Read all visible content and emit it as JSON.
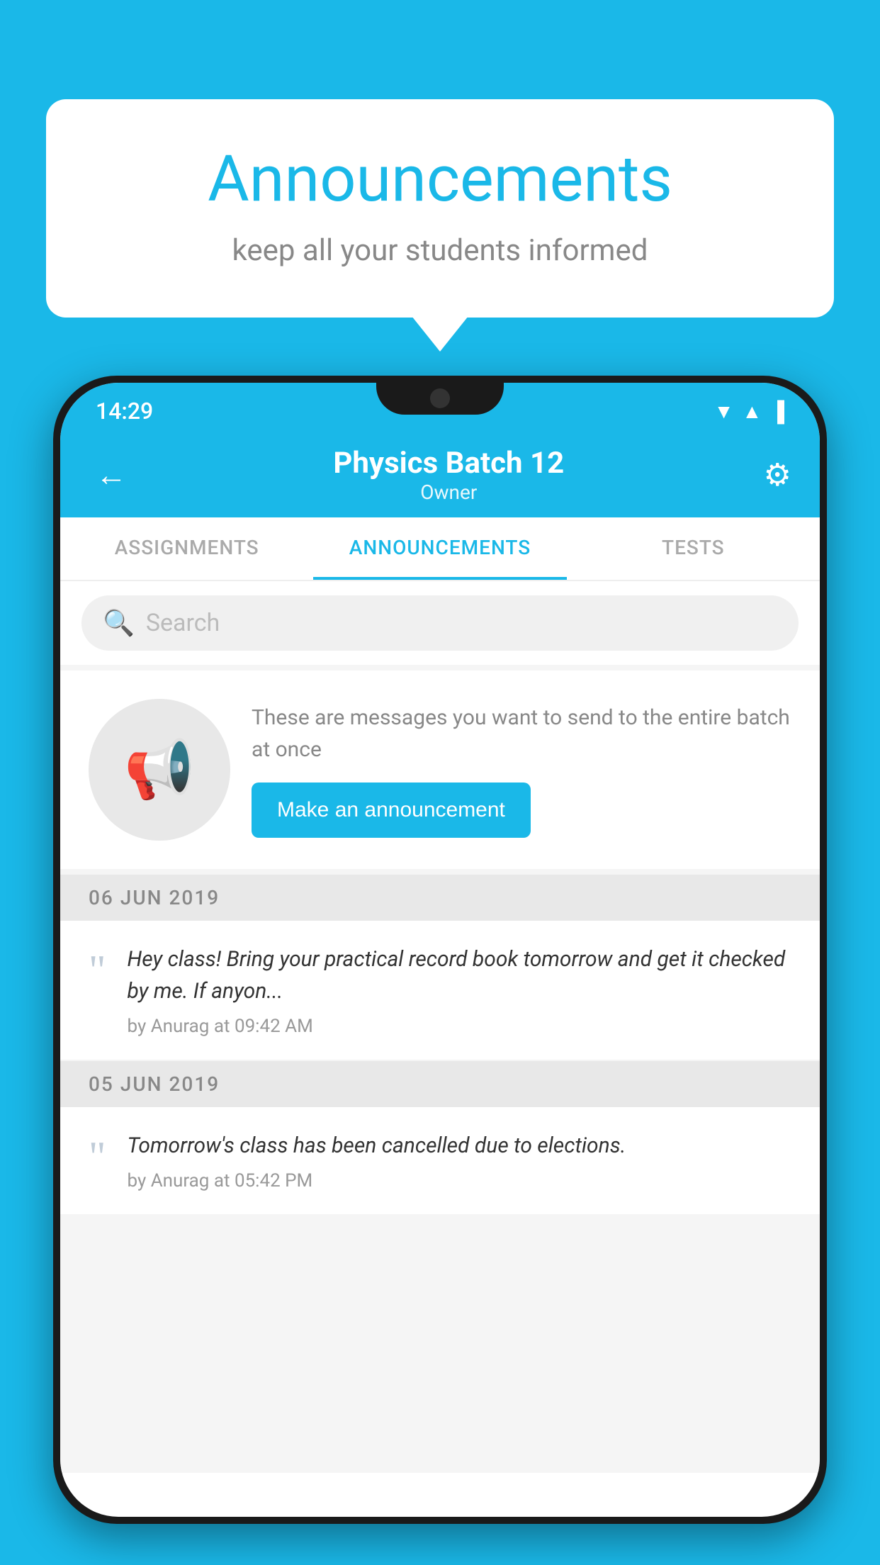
{
  "background_color": "#1ab8e8",
  "speech_bubble": {
    "title": "Announcements",
    "subtitle": "keep all your students informed"
  },
  "phone": {
    "status_bar": {
      "time": "14:29",
      "wifi": "▲",
      "signal": "▲",
      "battery": "▐"
    },
    "app_bar": {
      "back_label": "←",
      "title": "Physics Batch 12",
      "subtitle": "Owner",
      "settings_label": "⚙"
    },
    "tabs": [
      {
        "label": "ASSIGNMENTS",
        "active": false
      },
      {
        "label": "ANNOUNCEMENTS",
        "active": true
      },
      {
        "label": "TESTS",
        "active": false
      }
    ],
    "search": {
      "placeholder": "Search"
    },
    "announcement_prompt": {
      "description": "These are messages you want to send to the entire batch at once",
      "button_label": "Make an announcement"
    },
    "announcements": [
      {
        "date": "06  JUN  2019",
        "text": "Hey class! Bring your practical record book tomorrow and get it checked by me. If anyon...",
        "meta": "by Anurag at 09:42 AM"
      },
      {
        "date": "05  JUN  2019",
        "text": "Tomorrow's class has been cancelled due to elections.",
        "meta": "by Anurag at 05:42 PM"
      }
    ]
  }
}
